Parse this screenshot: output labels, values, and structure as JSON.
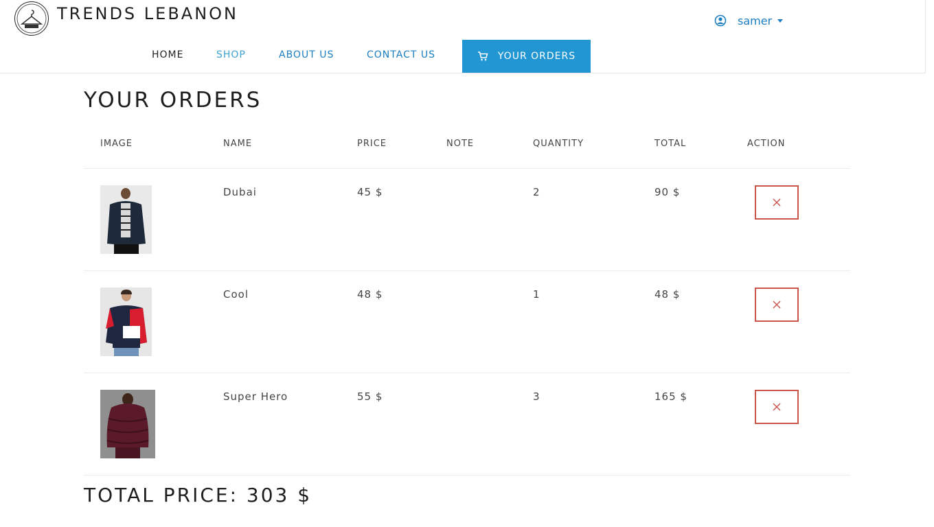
{
  "brand": {
    "name": "TRENDS LEBANON",
    "logo_icon": "hanger-logo-icon"
  },
  "user": {
    "name": "samer",
    "icon": "user-circle-icon"
  },
  "nav": {
    "home": "HOME",
    "shop": "SHOP",
    "about": "ABOUT US",
    "contact": "CONTACT US",
    "orders": "YOUR ORDERS"
  },
  "page": {
    "title": "YOUR ORDERS"
  },
  "table": {
    "headers": [
      "IMAGE",
      "NAME",
      "PRICE",
      "NOTE",
      "QUANTITY",
      "TOTAL",
      "ACTION"
    ],
    "rows": [
      {
        "name": "Dubai",
        "price": "45 $",
        "note": "",
        "quantity": "2",
        "total": "90 $"
      },
      {
        "name": "Cool",
        "price": "48 $",
        "note": "",
        "quantity": "1",
        "total": "48 $"
      },
      {
        "name": "Super Hero",
        "price": "55 $",
        "note": "",
        "quantity": "3",
        "total": "165 $"
      }
    ]
  },
  "summary": {
    "total_label": "TOTAL PRICE: 303 $"
  },
  "colors": {
    "accent": "#2196d3",
    "link": "#1b7ec2",
    "danger": "#c9524a"
  }
}
